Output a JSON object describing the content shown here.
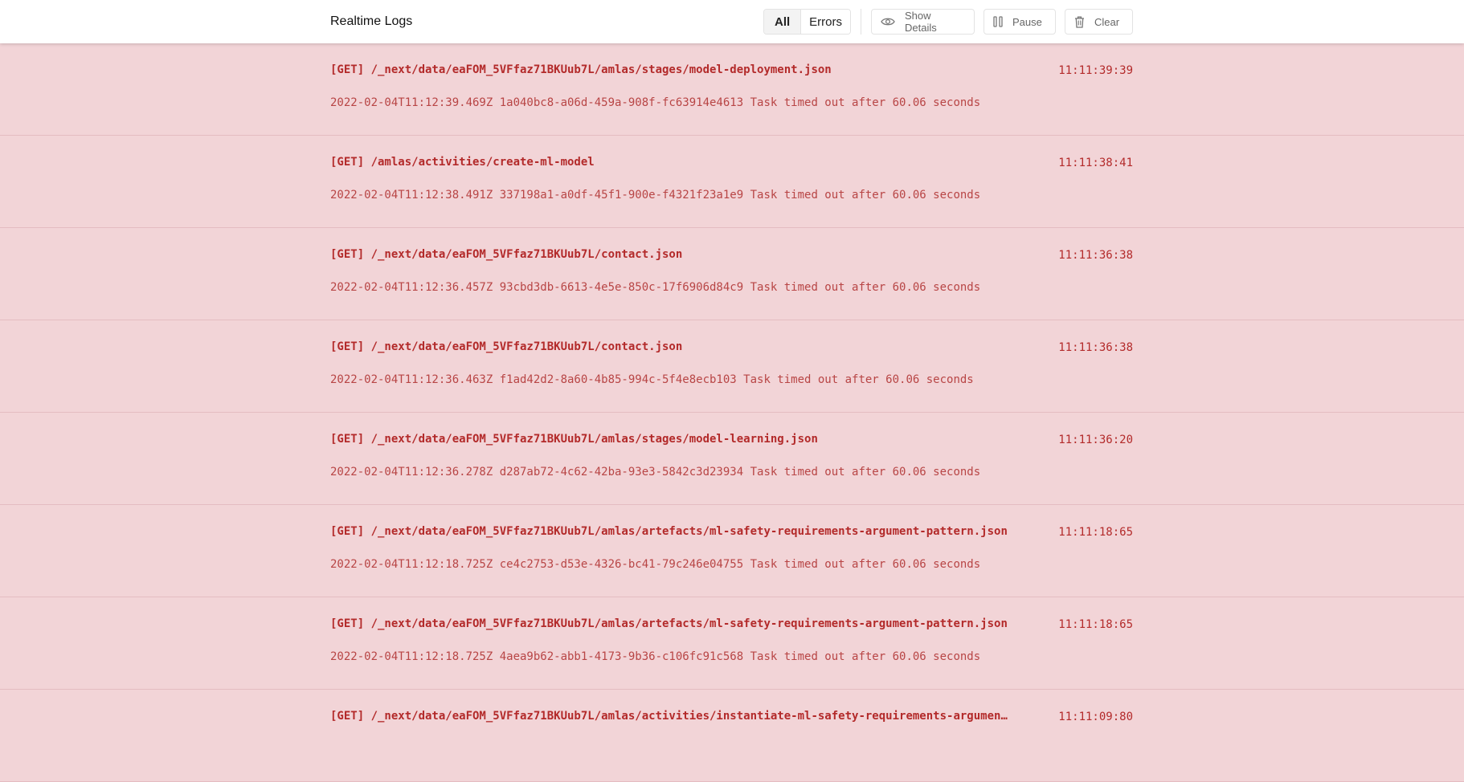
{
  "header": {
    "title": "Realtime Logs",
    "filters": [
      {
        "label": "All",
        "active": true
      },
      {
        "label": "Errors",
        "active": false
      }
    ],
    "show_details_label": "Show Details",
    "pause_label": "Pause",
    "clear_label": "Clear"
  },
  "colors": {
    "error_background": "#f2d4d7",
    "error_text": "#b32a2a"
  },
  "logs": [
    {
      "path": "[GET] /_next/data/eaFOM_5VFfaz71BKUub7L/amlas/stages/model-deployment.json",
      "time": "11:11:39:39",
      "message": "2022-02-04T11:12:39.469Z 1a040bc8-a06d-459a-908f-fc63914e4613 Task timed out after 60.06 seconds"
    },
    {
      "path": "[GET] /amlas/activities/create-ml-model",
      "time": "11:11:38:41",
      "message": "2022-02-04T11:12:38.491Z 337198a1-a0df-45f1-900e-f4321f23a1e9 Task timed out after 60.06 seconds"
    },
    {
      "path": "[GET] /_next/data/eaFOM_5VFfaz71BKUub7L/contact.json",
      "time": "11:11:36:38",
      "message": "2022-02-04T11:12:36.457Z 93cbd3db-6613-4e5e-850c-17f6906d84c9 Task timed out after 60.06 seconds"
    },
    {
      "path": "[GET] /_next/data/eaFOM_5VFfaz71BKUub7L/contact.json",
      "time": "11:11:36:38",
      "message": "2022-02-04T11:12:36.463Z f1ad42d2-8a60-4b85-994c-5f4e8ecb103 Task timed out after 60.06 seconds"
    },
    {
      "path": "[GET] /_next/data/eaFOM_5VFfaz71BKUub7L/amlas/stages/model-learning.json",
      "time": "11:11:36:20",
      "message": "2022-02-04T11:12:36.278Z d287ab72-4c62-42ba-93e3-5842c3d23934 Task timed out after 60.06 seconds"
    },
    {
      "path": "[GET] /_next/data/eaFOM_5VFfaz71BKUub7L/amlas/artefacts/ml-safety-requirements-argument-pattern.json",
      "time": "11:11:18:65",
      "message": "2022-02-04T11:12:18.725Z ce4c2753-d53e-4326-bc41-79c246e04755 Task timed out after 60.06 seconds"
    },
    {
      "path": "[GET] /_next/data/eaFOM_5VFfaz71BKUub7L/amlas/artefacts/ml-safety-requirements-argument-pattern.json",
      "time": "11:11:18:65",
      "message": "2022-02-04T11:12:18.725Z 4aea9b62-abb1-4173-9b36-c106fc91c568 Task timed out after 60.06 seconds"
    },
    {
      "path": "[GET] /_next/data/eaFOM_5VFfaz71BKUub7L/amlas/activities/instantiate-ml-safety-requirements-argumen…",
      "time": "11:11:09:80",
      "message": ""
    }
  ]
}
